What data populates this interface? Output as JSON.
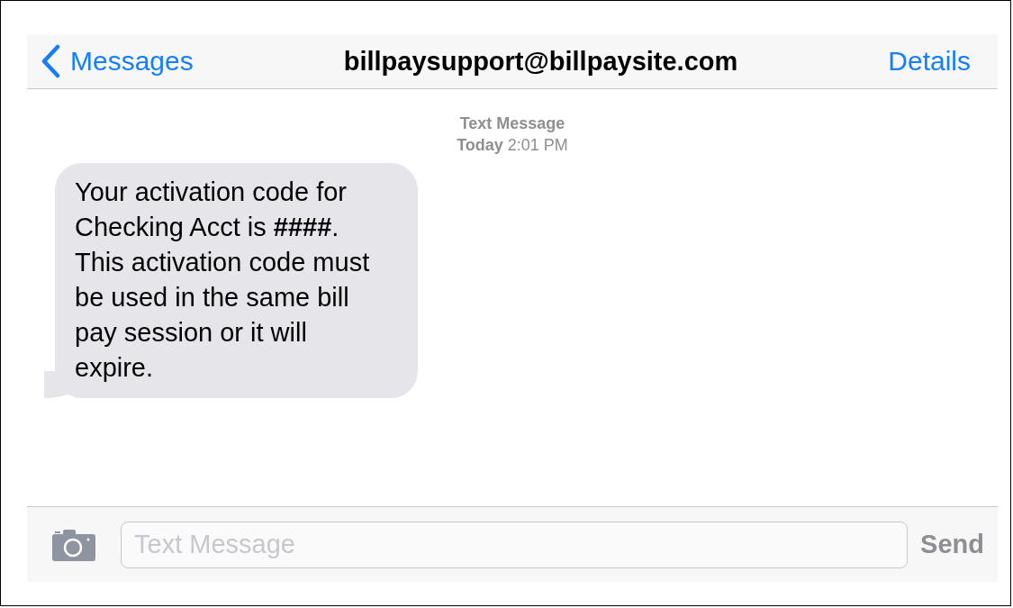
{
  "nav_bar": {
    "back": "Messages",
    "title": "billpaysupport@billpaysite.com",
    "action": "Details"
  },
  "timestamp": {
    "label": "Text Message",
    "time": "**Today** 2:01 PM"
  },
  "messages": [
    {
      "text": "Your activation code for Checking Acct is **####**. This activation code must be used in the same bill pay session or it will expire."
    }
  ],
  "composer": {
    "placeholder": "Text Message",
    "send": "Send"
  }
}
